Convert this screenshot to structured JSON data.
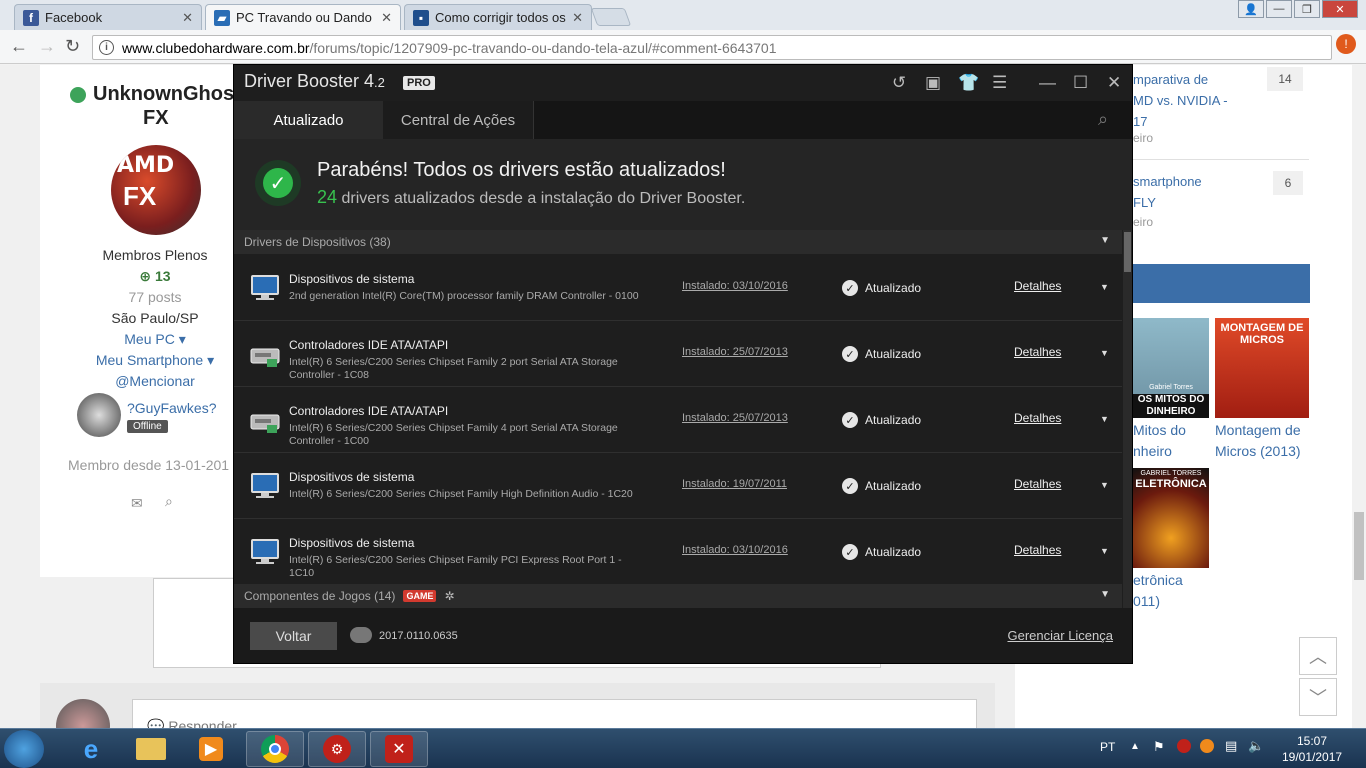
{
  "browser": {
    "tabs": [
      {
        "title": "Facebook",
        "favicon": "facebook-icon",
        "color": "#3b5998"
      },
      {
        "title": "PC Travando ou Dando T",
        "favicon": "clubedohardware-icon",
        "color": "#2a6db5"
      },
      {
        "title": "Como corrigir todos os e",
        "favicon": "page-icon",
        "color": "#1f4e8c"
      }
    ],
    "url_host": "www.clubedohardware.com.br",
    "url_path": "/forums/topic/1207909-pc-travando-ou-dando-tela-azul/#comment-6643701"
  },
  "forum": {
    "username": "UnknownGhost FX",
    "username_line1": "UnknownGhos",
    "username_line2": "FX",
    "rank": "Membros Plenos",
    "reputation": "13",
    "posts": "77 posts",
    "location": "São Paulo/SP",
    "meu_pc": "Meu PC",
    "meu_smartphone": "Meu Smartphone",
    "mencionar": "@Mencionar",
    "follower_name": "?GuyFawkes?",
    "follower_status": "Offline",
    "member_since": "Membro desde 13-01-201",
    "reply_prompt": "Responder",
    "side_topics": [
      {
        "title_l1": "mparativa de",
        "title_l2": "MD vs. NVIDIA -",
        "title_l3": "17",
        "meta": "eiro",
        "count": "14"
      },
      {
        "title_l1": "smartphone",
        "title_l2": "FLY",
        "title_l3": "",
        "meta": "eiro",
        "count": "6"
      }
    ],
    "books": [
      {
        "cover_top": "Gabriel Torres",
        "cover_title": "OS MITOS DO DINHEIRO",
        "caption_l1": "Mitos do",
        "caption_l2": "nheiro"
      },
      {
        "cover_top": "MONTAGEM DE MICROS",
        "cover_title": "",
        "caption_l1": "Montagem de",
        "caption_l2": "Micros (2013)"
      },
      {
        "cover_top": "GABRIEL TORRES",
        "cover_title": "ELETRÔNICA",
        "caption_l1": "etrônica",
        "caption_l2": "011)"
      }
    ]
  },
  "driver_booster": {
    "title": "Driver Booster 4.2",
    "title_main": "Driver Booster 4",
    "title_minor": ".2",
    "pro_badge": "PRO",
    "tab_updated": "Atualizado",
    "tab_actions": "Central de Ações",
    "headline": "Parabéns! Todos os drivers estão atualizados!",
    "updated_count": "24",
    "updated_text": "drivers atualizados desde a instalação do Driver Booster.",
    "section_devices": "Drivers de Dispositivos (38)",
    "section_games": "Componentes de Jogos (14)",
    "game_badge": "GAME",
    "drivers": [
      {
        "name": "Dispositivos de sistema",
        "desc": "2nd generation Intel(R) Core(TM) processor family DRAM Controller - 0100",
        "installed": "Instalado: 03/10/2016",
        "status": "Atualizado",
        "details": "Detalhes",
        "icon": "monitor-icon"
      },
      {
        "name": "Controladores IDE ATA/ATAPI",
        "desc": "Intel(R) 6 Series/C200 Series Chipset Family 2 port Serial ATA Storage Controller - 1C08",
        "installed": "Instalado: 25/07/2013",
        "status": "Atualizado",
        "details": "Detalhes",
        "icon": "drive-icon"
      },
      {
        "name": "Controladores IDE ATA/ATAPI",
        "desc": "Intel(R) 6 Series/C200 Series Chipset Family 4 port Serial ATA Storage Controller - 1C00",
        "installed": "Instalado: 25/07/2013",
        "status": "Atualizado",
        "details": "Detalhes",
        "icon": "drive-icon"
      },
      {
        "name": "Dispositivos de sistema",
        "desc": "Intel(R) 6 Series/C200 Series Chipset Family High Definition Audio - 1C20",
        "installed": "Instalado: 19/07/2011",
        "status": "Atualizado",
        "details": "Detalhes",
        "icon": "monitor-icon"
      },
      {
        "name": "Dispositivos de sistema",
        "desc": "Intel(R) 6 Series/C200 Series Chipset Family PCI Express Root Port 1 - 1C10",
        "installed": "Instalado: 03/10/2016",
        "status": "Atualizado",
        "details": "Detalhes",
        "icon": "monitor-icon"
      }
    ],
    "back_button": "Voltar",
    "version": "2017.0110.0635",
    "license_link": "Gerenciar Licença",
    "accent_color": "#2eb64a"
  },
  "taskbar": {
    "language": "PT",
    "time": "15:07",
    "date": "19/01/2017"
  }
}
